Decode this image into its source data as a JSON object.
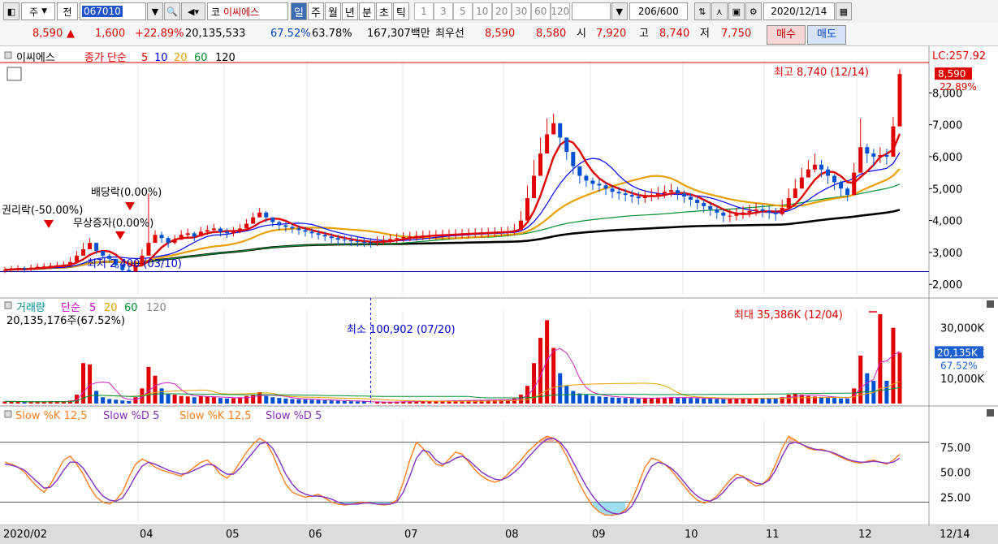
{
  "toolbar": {
    "market": "주",
    "prev": "전",
    "code": "067010",
    "market_tag": "코",
    "name": "이씨에스",
    "periods": [
      "일",
      "주",
      "월",
      "년",
      "분",
      "초",
      "틱"
    ],
    "active_period": "일",
    "numbers": [
      "1",
      "3",
      "5",
      "10",
      "20",
      "30",
      "60",
      "120"
    ],
    "count": "206",
    "max_count": "/600",
    "date": "2020/12/14"
  },
  "quote": {
    "price": "8,590",
    "change": "1,600",
    "change_pct": "+22.89%",
    "volume": "20,135,533",
    "vol_pct": "67.52%",
    "turnover": "63.78%",
    "amount": "167,307백만",
    "best_label": "최우선",
    "ask": "8,590",
    "bid": "8,580",
    "open_label": "시",
    "open": "7,920",
    "high_label": "고",
    "high": "8,740",
    "low_label": "저",
    "low": "7,750",
    "buy_label": "매수",
    "sell_label": "매도"
  },
  "price_panel": {
    "stock_name": "이씨에스",
    "ma_label": "종가 단순",
    "ma_periods": [
      "5",
      "10",
      "20",
      "60",
      "120"
    ],
    "lc_label": "LC:257.92",
    "last_price": "8,590",
    "last_pct": "22.89%",
    "high_annotation": "최고 8,740 (12/14)",
    "low_annotation": "최저 2,400 (03/10)",
    "events": [
      "권리락(-50.00%)",
      "배당락(0.00%)",
      "무상증자(0.00%)"
    ]
  },
  "volume_panel": {
    "title": "거래량",
    "ma_label": "단순",
    "ma_periods": [
      "5",
      "20",
      "60",
      "120"
    ],
    "current": "20,135,176주(67.52%)",
    "min_annotation": "최소 100,902 (07/20)",
    "max_annotation": "최대 35,386K (12/04)",
    "last_value": "20,135K",
    "last_pct": "67.52%"
  },
  "stoch_panel": {
    "labels": [
      "Slow %K 12,5",
      "Slow %D 5",
      "Slow %K 12,5",
      "Slow %D 5"
    ]
  },
  "colors": {
    "up": "#e00000",
    "down": "#0050d0",
    "ma5": "#e00000",
    "ma10": "#0000ff",
    "ma20": "#e8a000",
    "ma60": "#009030",
    "ma120": "#000000",
    "stochK": "#ff8020",
    "stochD": "#8030c0"
  },
  "chart_data": [
    {
      "type": "line",
      "chart": "candlestick",
      "x_labels": [
        "2020/02",
        "04",
        "05",
        "06",
        "07",
        "08",
        "09",
        "10",
        "11",
        "12",
        "12/14"
      ],
      "y_ticks": [
        2000,
        3000,
        4000,
        5000,
        6000,
        7000,
        8000
      ],
      "y_tick_labels": [
        "2,000",
        "3,000",
        "4,000",
        "5,000",
        "6,000",
        "7,000",
        "8,000"
      ],
      "ylim": [
        1700,
        8900
      ],
      "close": [
        2450,
        2480,
        2500,
        2470,
        2520,
        2550,
        2560,
        2580,
        2600,
        2620,
        2700,
        2900,
        3100,
        3300,
        3050,
        2900,
        2800,
        2600,
        2450,
        2400,
        2600,
        2900,
        3300,
        3550,
        3450,
        3300,
        3400,
        3550,
        3600,
        3500,
        3650,
        3700,
        3750,
        3650,
        3600,
        3650,
        3750,
        3900,
        4100,
        4250,
        4100,
        3950,
        3850,
        3800,
        3750,
        3700,
        3650,
        3600,
        3550,
        3500,
        3450,
        3400,
        3380,
        3350,
        3330,
        3320,
        3300,
        3350,
        3380,
        3420,
        3450,
        3480,
        3500,
        3520,
        3530,
        3540,
        3550,
        3560,
        3570,
        3580,
        3590,
        3600,
        3610,
        3620,
        3630,
        3640,
        3650,
        3660,
        3700,
        4000,
        4700,
        5400,
        6100,
        6700,
        7050,
        6600,
        6150,
        5700,
        5400,
        5250,
        5150,
        5100,
        5000,
        4900,
        4850,
        4800,
        4750,
        4700,
        4750,
        4800,
        4850,
        4900,
        4950,
        4850,
        4750,
        4650,
        4550,
        4450,
        4350,
        4250,
        4150,
        4150,
        4200,
        4250,
        4300,
        4350,
        4300,
        4250,
        4200,
        4400,
        4700,
        5000,
        5350,
        5600,
        5750,
        5600,
        5400,
        5200,
        5000,
        4800,
        5500,
        6300,
        6100,
        6000,
        6050,
        6000,
        6950,
        8590
      ],
      "high": [
        2550,
        2580,
        2600,
        2570,
        2620,
        2650,
        2660,
        2680,
        2700,
        2720,
        2850,
        3050,
        3300,
        3450,
        3250,
        3050,
        2950,
        2750,
        2600,
        2550,
        2750,
        3100,
        4850,
        3700,
        3650,
        3500,
        3550,
        3700,
        3750,
        3650,
        3800,
        3850,
        3900,
        3800,
        3750,
        3800,
        3900,
        4050,
        4250,
        4400,
        4300,
        4100,
        4000,
        3950,
        3900,
        3850,
        3800,
        3750,
        3700,
        3650,
        3600,
        3550,
        3530,
        3500,
        3480,
        3470,
        3450,
        3500,
        3530,
        3570,
        3600,
        3630,
        3650,
        3670,
        3680,
        3690,
        3700,
        3710,
        3720,
        3730,
        3740,
        3750,
        3760,
        3770,
        3780,
        3790,
        3800,
        3810,
        3900,
        4300,
        5100,
        5900,
        6600,
        7200,
        7350,
        7000,
        6500,
        6000,
        5650,
        5450,
        5350,
        5300,
        5200,
        5100,
        5050,
        5000,
        4950,
        4900,
        4950,
        5000,
        5050,
        5100,
        5150,
        5050,
        4950,
        4850,
        4750,
        4650,
        4550,
        4450,
        4350,
        4350,
        4400,
        4450,
        4500,
        4550,
        4500,
        4450,
        4400,
        4650,
        5000,
        5300,
        5650,
        5900,
        6100,
        5900,
        5700,
        5450,
        5250,
        5050,
        5800,
        7200,
        6400,
        6250,
        6300,
        6250,
        7250,
        8740
      ],
      "low": [
        2350,
        2380,
        2400,
        2370,
        2420,
        2450,
        2460,
        2480,
        2500,
        2520,
        2600,
        2800,
        3000,
        3150,
        2950,
        2800,
        2700,
        2500,
        2400,
        2400,
        2500,
        2800,
        3150,
        3400,
        3300,
        3150,
        3250,
        3400,
        3450,
        3350,
        3500,
        3550,
        3600,
        3500,
        3450,
        3500,
        3600,
        3750,
        3950,
        4100,
        3950,
        3800,
        3700,
        3650,
        3600,
        3550,
        3500,
        3450,
        3400,
        3350,
        3300,
        3250,
        3230,
        3200,
        3180,
        3170,
        3150,
        3200,
        3230,
        3270,
        3300,
        3330,
        3350,
        3370,
        3380,
        3390,
        3400,
        3410,
        3420,
        3430,
        3440,
        3450,
        3460,
        3470,
        3480,
        3490,
        3500,
        3510,
        3550,
        3800,
        4400,
        5100,
        5700,
        6300,
        6700,
        6300,
        5900,
        5450,
        5150,
        5050,
        4950,
        4900,
        4800,
        4700,
        4650,
        4600,
        4550,
        4500,
        4550,
        4600,
        4650,
        4700,
        4750,
        4650,
        4550,
        4450,
        4350,
        4250,
        4150,
        4050,
        3950,
        3950,
        4000,
        4050,
        4100,
        4150,
        4100,
        4050,
        4000,
        4150,
        4450,
        4750,
        5050,
        5350,
        5500,
        5350,
        5150,
        4950,
        4750,
        4600,
        5050,
        5850,
        5800,
        5700,
        5800,
        5750,
        6300,
        7750
      ],
      "ma5_note": "MA lines drawn from close series",
      "hline": 2400
    },
    {
      "type": "bar",
      "chart": "volume",
      "y_ticks": [
        10000,
        20000,
        30000
      ],
      "y_tick_labels": [
        "10,000K",
        "20,000K",
        "30,000K"
      ],
      "ylim": [
        0,
        36000
      ],
      "values_k": [
        800,
        900,
        700,
        600,
        650,
        700,
        800,
        900,
        750,
        700,
        1200,
        3500,
        16000,
        15500,
        5000,
        2500,
        1800,
        1500,
        1200,
        1000,
        2500,
        6000,
        14500,
        11000,
        6000,
        4000,
        3500,
        3000,
        2800,
        2500,
        3000,
        2700,
        2500,
        2200,
        2000,
        2100,
        2500,
        3000,
        3500,
        4500,
        3000,
        2500,
        2200,
        2000,
        1800,
        1700,
        1600,
        1500,
        1400,
        1300,
        1200,
        1100,
        1000,
        900,
        850,
        800,
        100,
        700,
        650,
        700,
        750,
        800,
        850,
        900,
        950,
        1000,
        1050,
        1100,
        1150,
        1200,
        1250,
        1300,
        1350,
        1400,
        1450,
        1500,
        1550,
        1600,
        2000,
        3500,
        7000,
        16000,
        26000,
        33000,
        22000,
        12000,
        7000,
        5000,
        4000,
        3500,
        3000,
        2800,
        2600,
        2400,
        2300,
        2200,
        2100,
        2000,
        2100,
        2200,
        2300,
        2400,
        2500,
        2400,
        2300,
        2200,
        2100,
        2000,
        1900,
        1800,
        1700,
        1800,
        1900,
        2000,
        2100,
        2200,
        2100,
        2000,
        1900,
        2500,
        3500,
        4000,
        3500,
        3000,
        2800,
        2600,
        2400,
        2200,
        2000,
        1900,
        6000,
        19000,
        12000,
        9000,
        35386,
        9000,
        30000,
        20135
      ]
    },
    {
      "type": "line",
      "chart": "stochastic",
      "y_ticks": [
        25,
        50,
        75
      ],
      "y_tick_labels": [
        "25.00",
        "50.00",
        "75.00"
      ],
      "ylim": [
        0,
        100
      ],
      "levels": [
        20,
        80
      ],
      "slow_k": [
        60,
        58,
        55,
        50,
        42,
        35,
        30,
        38,
        50,
        62,
        66,
        58,
        48,
        35,
        25,
        20,
        18,
        22,
        30,
        45,
        58,
        63,
        60,
        55,
        52,
        50,
        48,
        46,
        50,
        55,
        60,
        62,
        56,
        48,
        44,
        50,
        60,
        70,
        78,
        84,
        80,
        68,
        52,
        38,
        30,
        27,
        25,
        26,
        28,
        24,
        20,
        18,
        17,
        18,
        19,
        20,
        19,
        18,
        17,
        18,
        22,
        40,
        62,
        80,
        74,
        66,
        58,
        56,
        63,
        70,
        68,
        60,
        52,
        46,
        42,
        40,
        42,
        48,
        55,
        62,
        70,
        76,
        82,
        86,
        84,
        78,
        66,
        52,
        38,
        26,
        16,
        10,
        7,
        7,
        8,
        12,
        22,
        38,
        55,
        64,
        62,
        58,
        52,
        44,
        36,
        28,
        22,
        19,
        21,
        26,
        34,
        42,
        48,
        46,
        40,
        36,
        38,
        44,
        58,
        74,
        86,
        82,
        78,
        74,
        72,
        73,
        71,
        68,
        65,
        62,
        60,
        59,
        61,
        62,
        60,
        58,
        62,
        68
      ],
      "slow_d": [
        58,
        57,
        55,
        52,
        46,
        40,
        34,
        35,
        42,
        52,
        60,
        60,
        54,
        44,
        34,
        26,
        22,
        21,
        24,
        34,
        46,
        56,
        60,
        58,
        55,
        52,
        50,
        48,
        49,
        52,
        55,
        58,
        57,
        52,
        48,
        48,
        54,
        62,
        70,
        78,
        80,
        74,
        62,
        48,
        38,
        31,
        28,
        26,
        26,
        25,
        23,
        20,
        18,
        18,
        18,
        19,
        19,
        18,
        18,
        18,
        20,
        30,
        46,
        64,
        72,
        70,
        62,
        58,
        60,
        64,
        66,
        62,
        56,
        50,
        46,
        43,
        42,
        45,
        50,
        56,
        64,
        71,
        78,
        83,
        84,
        80,
        72,
        60,
        48,
        36,
        26,
        18,
        12,
        9,
        8,
        10,
        16,
        28,
        44,
        56,
        60,
        58,
        54,
        48,
        40,
        32,
        26,
        22,
        21,
        24,
        30,
        38,
        44,
        45,
        42,
        39,
        38,
        42,
        52,
        66,
        78,
        80,
        78,
        75,
        73,
        72,
        71,
        69,
        66,
        63,
        61,
        60,
        60,
        61,
        60,
        59,
        60,
        64
      ]
    }
  ]
}
